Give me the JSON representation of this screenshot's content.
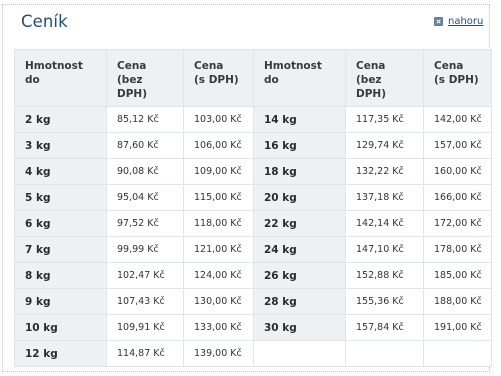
{
  "title": "Ceník",
  "top_link": "nahoru",
  "columns": [
    "Hmotnost\ndo",
    "Cena\n(bez\nDPH)",
    "Cena\n(s DPH)",
    "Hmotnost\ndo",
    "Cena\n(bez DPH)",
    "Cena\n(s DPH)"
  ],
  "rows": [
    {
      "w1": "2 kg",
      "p1": "85,12 Kč",
      "d1": "103,00 Kč",
      "w2": "14 kg",
      "p2": "117,35 Kč",
      "d2": "142,00 Kč"
    },
    {
      "w1": "3 kg",
      "p1": "87,60 Kč",
      "d1": "106,00 Kč",
      "w2": "16 kg",
      "p2": "129,74 Kč",
      "d2": "157,00 Kč"
    },
    {
      "w1": "4 kg",
      "p1": "90,08 Kč",
      "d1": "109,00 Kč",
      "w2": "18 kg",
      "p2": "132,22 Kč",
      "d2": "160,00 Kč"
    },
    {
      "w1": "5 kg",
      "p1": "95,04 Kč",
      "d1": "115,00 Kč",
      "w2": "20 kg",
      "p2": "137,18 Kč",
      "d2": "166,00 Kč"
    },
    {
      "w1": "6 kg",
      "p1": "97,52 Kč",
      "d1": "118,00 Kč",
      "w2": "22 kg",
      "p2": "142,14 Kč",
      "d2": "172,00 Kč"
    },
    {
      "w1": "7 kg",
      "p1": "99,99 Kč",
      "d1": "121,00 Kč",
      "w2": "24 kg",
      "p2": "147,10 Kč",
      "d2": "178,00 Kč"
    },
    {
      "w1": "8 kg",
      "p1": "102,47 Kč",
      "d1": "124,00 Kč",
      "w2": "26 kg",
      "p2": "152,88 Kč",
      "d2": "185,00 Kč"
    },
    {
      "w1": "9 kg",
      "p1": "107,43 Kč",
      "d1": "130,00 Kč",
      "w2": "28 kg",
      "p2": "155,36 Kč",
      "d2": "188,00 Kč"
    },
    {
      "w1": "10 kg",
      "p1": "109,91 Kč",
      "d1": "133,00 Kč",
      "w2": "30 kg",
      "p2": "157,84 Kč",
      "d2": "191,00 Kč"
    },
    {
      "w1": "12 kg",
      "p1": "114,87 Kč",
      "d1": "139,00 Kč",
      "w2": "",
      "p2": "",
      "d2": ""
    }
  ]
}
